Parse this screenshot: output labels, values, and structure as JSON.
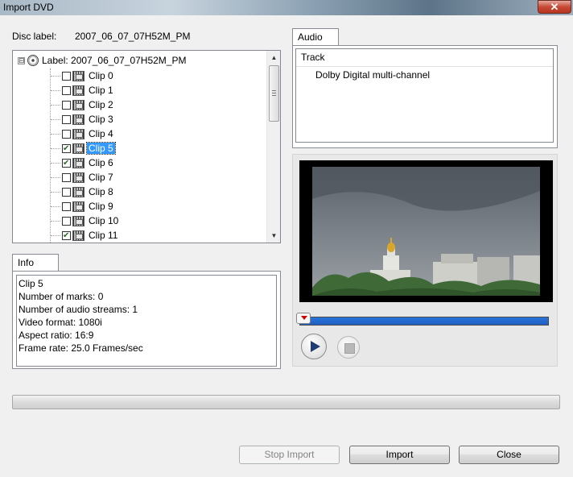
{
  "window": {
    "title": "Import DVD",
    "close_glyph": "✕"
  },
  "disc": {
    "label_caption": "Disc label:",
    "label_value": "2007_06_07_07H52M_PM"
  },
  "tree": {
    "root_label": "Label: 2007_06_07_07H52M_PM",
    "expander_glyph": "⊟",
    "clips": [
      {
        "label": "Clip 0",
        "checked": false,
        "selected": false
      },
      {
        "label": "Clip 1",
        "checked": false,
        "selected": false
      },
      {
        "label": "Clip 2",
        "checked": false,
        "selected": false
      },
      {
        "label": "Clip 3",
        "checked": false,
        "selected": false
      },
      {
        "label": "Clip 4",
        "checked": false,
        "selected": false
      },
      {
        "label": "Clip 5",
        "checked": true,
        "selected": true
      },
      {
        "label": "Clip 6",
        "checked": true,
        "selected": false
      },
      {
        "label": "Clip 7",
        "checked": false,
        "selected": false
      },
      {
        "label": "Clip 8",
        "checked": false,
        "selected": false
      },
      {
        "label": "Clip 9",
        "checked": false,
        "selected": false
      },
      {
        "label": "Clip 10",
        "checked": false,
        "selected": false
      },
      {
        "label": "Clip 11",
        "checked": true,
        "selected": false
      }
    ],
    "scroll_up_glyph": "▲",
    "scroll_down_glyph": "▼"
  },
  "info": {
    "tab_label": "Info",
    "lines": [
      "Clip 5",
      "Number of marks: 0",
      "Number of audio streams: 1",
      "Video format: 1080i",
      "Aspect ratio: 16:9",
      "Frame rate: 25.0 Frames/sec"
    ]
  },
  "audio": {
    "tab_label": "Audio",
    "column_header": "Track",
    "tracks": [
      "Dolby Digital multi-channel"
    ]
  },
  "player": {
    "position": 0.0
  },
  "buttons": {
    "stop_import": "Stop Import",
    "import": "Import",
    "close": "Close"
  },
  "colors": {
    "selection": "#3399ff",
    "progress_fill": "#2a73d9"
  }
}
